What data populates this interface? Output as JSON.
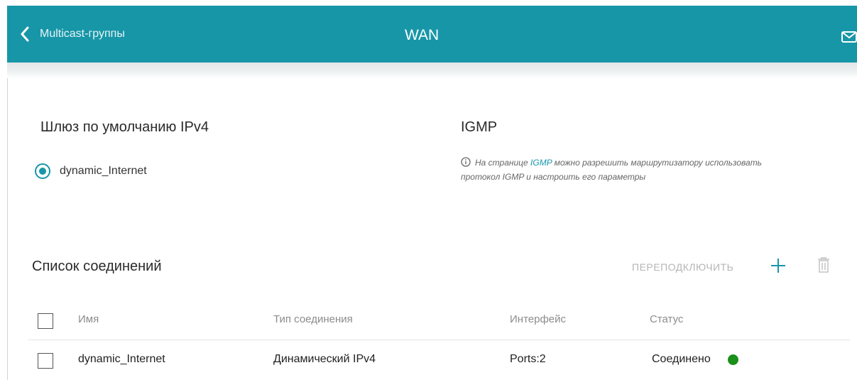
{
  "header": {
    "back_label": "Multicast-группы",
    "title": "WAN",
    "icons": {
      "back": "chevron-left-icon",
      "mail": "mail-icon"
    }
  },
  "gateway": {
    "title": "Шлюз по умолчанию IPv4",
    "selected_option": "dynamic_Internet"
  },
  "igmp": {
    "title": "IGMP",
    "info_prefix": "На странице ",
    "info_link": "IGMP",
    "info_suffix": " можно разрешить маршрутизатору использовать протокол IGMP и настроить его параметры"
  },
  "connections": {
    "title": "Список соединений",
    "reconnect_label": "ПЕРЕПОДКЛЮЧИТЬ",
    "columns": [
      "Имя",
      "Тип соединения",
      "Интерфейс",
      "Статус"
    ],
    "rows": [
      {
        "name": "dynamic_Internet",
        "type": "Динамический IPv4",
        "interface": "Ports:2",
        "status": "Соединено"
      }
    ],
    "status_color": "#1a8f1a"
  },
  "colors": {
    "accent": "#1796a8"
  }
}
